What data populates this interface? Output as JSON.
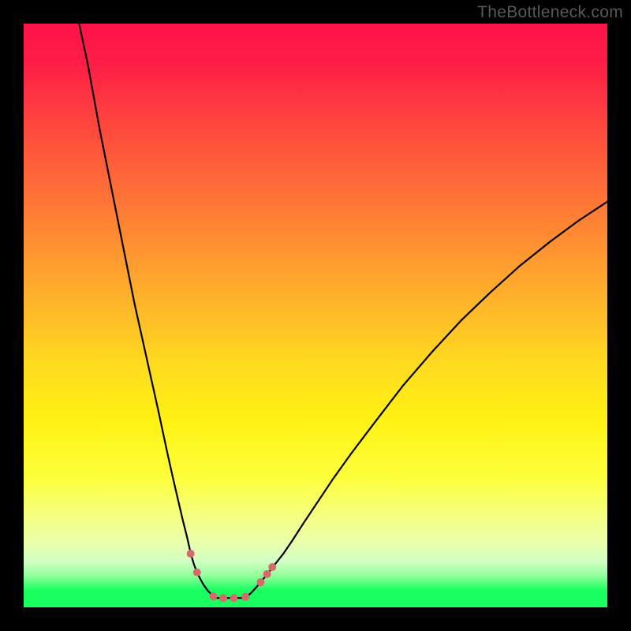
{
  "watermark": "TheBottleneck.com",
  "chart_data": {
    "type": "line",
    "title": "",
    "xlabel": "",
    "ylabel": "",
    "xlim": [
      0,
      100
    ],
    "ylim": [
      0,
      100
    ],
    "grid": false,
    "series": [
      {
        "name": "left-branch",
        "x": [
          9.5,
          11,
          13,
          15,
          17,
          19,
          21,
          23,
          24.5,
          25.5,
          26.5,
          27.3,
          28,
          28.5,
          28.8,
          29.2,
          29.5,
          29.8,
          30.3,
          30.8,
          31.5,
          32.2,
          33
        ],
        "y": [
          100,
          93,
          82,
          72,
          62,
          52,
          43,
          34,
          27,
          22.5,
          18.2,
          14.8,
          12,
          9.8,
          8.6,
          7.3,
          6.5,
          5.8,
          4.8,
          3.9,
          2.9,
          2.2,
          1.6
        ]
      },
      {
        "name": "right-branch",
        "x": [
          38,
          39,
          40,
          41,
          42,
          43,
          44.5,
          46,
          48,
          50,
          53,
          56,
          60,
          65,
          70,
          75,
          80,
          85,
          90,
          95,
          100
        ],
        "y": [
          1.6,
          2.5,
          3.6,
          4.8,
          6,
          7.3,
          9.2,
          11.4,
          14.5,
          17.5,
          22,
          26.2,
          31.5,
          38,
          43.8,
          49.2,
          54,
          58.5,
          62.5,
          66.2,
          69.5
        ]
      }
    ],
    "trough": {
      "name": "valley-floor",
      "x_range": [
        33,
        38
      ],
      "y": 1.6
    },
    "markers": [
      {
        "name": "marker-left-1",
        "x": 28.6,
        "y": 9.2,
        "r": 5
      },
      {
        "name": "marker-left-2",
        "x": 29.7,
        "y": 6.0,
        "r": 5
      },
      {
        "name": "marker-bottom-1",
        "x": 32.5,
        "y": 1.9,
        "r": 5
      },
      {
        "name": "marker-bottom-2",
        "x": 34.2,
        "y": 1.6,
        "r": 5
      },
      {
        "name": "marker-bottom-3",
        "x": 36.0,
        "y": 1.6,
        "r": 5
      },
      {
        "name": "marker-bottom-4",
        "x": 38.0,
        "y": 1.8,
        "r": 5
      },
      {
        "name": "marker-right-1",
        "x": 40.6,
        "y": 4.3,
        "r": 5
      },
      {
        "name": "marker-right-2",
        "x": 41.7,
        "y": 5.7,
        "r": 5
      },
      {
        "name": "marker-right-3",
        "x": 42.6,
        "y": 6.9,
        "r": 5
      }
    ],
    "background_gradient": {
      "top": "#ff1349",
      "mid_upper": "#ffae2c",
      "mid": "#fff213",
      "lower": "#eaffad",
      "bottom": "#1aff60"
    },
    "marker_color": "#d66a6a",
    "curve_color": "#000000"
  }
}
